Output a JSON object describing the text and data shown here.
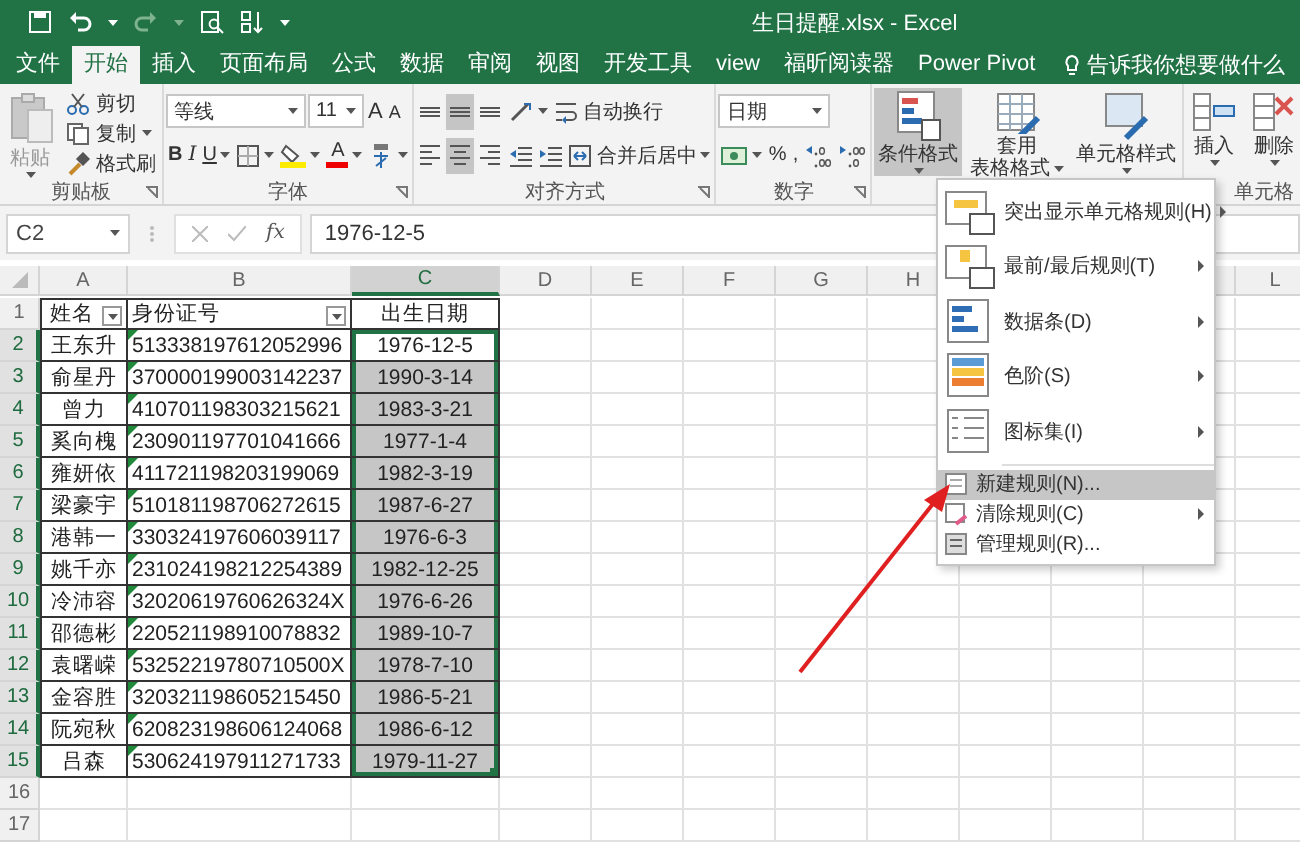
{
  "title_bar": {
    "title": "生日提醒.xlsx - Excel"
  },
  "tabs": [
    {
      "label": "文件",
      "selected": false
    },
    {
      "label": "开始",
      "selected": true
    },
    {
      "label": "插入",
      "selected": false
    },
    {
      "label": "页面布局",
      "selected": false
    },
    {
      "label": "公式",
      "selected": false
    },
    {
      "label": "数据",
      "selected": false
    },
    {
      "label": "审阅",
      "selected": false
    },
    {
      "label": "视图",
      "selected": false
    },
    {
      "label": "开发工具",
      "selected": false
    },
    {
      "label": "view",
      "selected": false
    },
    {
      "label": "福昕阅读器",
      "selected": false
    },
    {
      "label": "Power Pivot",
      "selected": false
    }
  ],
  "tell_me": "告诉我你想要做什么",
  "ribbon": {
    "groups": [
      {
        "label": "剪贴板",
        "launcher": true,
        "items": [
          {
            "kind": "paste",
            "label": "粘贴",
            "disabled": true,
            "dropdown": true
          },
          {
            "kind": "cut",
            "label": "剪切",
            "disabled": false,
            "dropdown": false
          },
          {
            "kind": "copy",
            "label": "复制",
            "disabled": false,
            "dropdown": true
          },
          {
            "kind": "brush",
            "label": "格式刷",
            "disabled": false,
            "dropdown": false
          }
        ]
      },
      {
        "label": "字体",
        "launcher": true,
        "lines": [
          [
            {
              "kind": "font-name",
              "value": "等线"
            },
            {
              "kind": "font-size",
              "value": "11"
            },
            {
              "kind": "grow",
              "label": "A"
            },
            {
              "kind": "shrink",
              "label": "A"
            }
          ],
          [
            {
              "kind": "bold",
              "label": "B"
            },
            {
              "kind": "italic",
              "label": "I"
            },
            {
              "kind": "underline",
              "label": "U",
              "dropdown": true
            },
            {
              "kind": "borders",
              "dropdown": true
            },
            {
              "kind": "fill-color",
              "dropdown": true
            },
            {
              "kind": "font-color",
              "label": "A",
              "dropdown": true
            },
            {
              "kind": "phonetic",
              "dropdown": true
            }
          ]
        ]
      },
      {
        "label": "对齐方式",
        "launcher": true,
        "lines": [
          [
            {
              "kind": "align-top",
              "pressed": false
            },
            {
              "kind": "align-middle",
              "pressed": true
            },
            {
              "kind": "align-bottom",
              "pressed": false
            },
            {
              "kind": "orientation",
              "pressed": false,
              "dropdown": true
            },
            {
              "kind": "wrap",
              "label": "自动换行",
              "pressed": false
            }
          ],
          [
            {
              "kind": "align-left",
              "pressed": false
            },
            {
              "kind": "align-center",
              "pressed": true
            },
            {
              "kind": "align-right",
              "pressed": false
            },
            {
              "kind": "indent-less",
              "pressed": false
            },
            {
              "kind": "indent-more",
              "pressed": false
            },
            {
              "kind": "merge",
              "label": "合并后居中",
              "pressed": false,
              "dropdown": true
            }
          ]
        ]
      },
      {
        "label": "数字",
        "launcher": true,
        "lines": [
          [
            {
              "kind": "format",
              "value": "日期"
            }
          ],
          [
            {
              "kind": "currency",
              "dropdown": true
            },
            {
              "kind": "percent",
              "label": "%"
            },
            {
              "kind": "comma",
              "label": ","
            },
            {
              "kind": "dec-more"
            },
            {
              "kind": "dec-less"
            }
          ]
        ]
      },
      {
        "items": [
          {
            "kind": "cond-format",
            "label": "条件格式",
            "pressed": true,
            "dropdown": true
          },
          {
            "kind": "table-format",
            "label_lines": [
              "套用",
              "表格格式"
            ],
            "pressed": false,
            "dropdown": true
          },
          {
            "kind": "cell-styles",
            "label": "单元格样式",
            "pressed": false,
            "dropdown": true
          }
        ]
      },
      {
        "label": "单元格",
        "launcher": false,
        "items": [
          {
            "kind": "insert",
            "label": "插入",
            "pressed": false,
            "dropdown": true
          },
          {
            "kind": "delete",
            "label": "删除",
            "pressed": false,
            "dropdown": true
          }
        ]
      }
    ]
  },
  "formula_bar": {
    "name_box": "C2",
    "function_button": "fx",
    "formula": "1976-12-5"
  },
  "sheet": {
    "columns": [
      {
        "label": "A",
        "selected": false
      },
      {
        "label": "B",
        "selected": false
      },
      {
        "label": "C",
        "selected": true
      },
      {
        "label": "D",
        "selected": false
      },
      {
        "label": "E",
        "selected": false
      },
      {
        "label": "F",
        "selected": false
      },
      {
        "label": "G",
        "selected": false
      },
      {
        "label": "H",
        "selected": false
      },
      {
        "label": "L",
        "selected": false
      }
    ],
    "rows": [
      {
        "label": "1",
        "selected": false,
        "cells": [
          {
            "text": "姓名",
            "filter": true,
            "selected": false
          },
          {
            "text": "身份证号",
            "filter": true,
            "selected": false
          },
          {
            "text": "出生日期",
            "filter": false,
            "selected": false
          }
        ]
      },
      {
        "label": "2",
        "selected": true,
        "cells": [
          {
            "text": "王东升",
            "selected": false
          },
          {
            "text": "513338197612052996",
            "flag": true,
            "selected": false
          },
          {
            "text": "1976-12-5",
            "selected": true,
            "active": true
          }
        ]
      },
      {
        "label": "3",
        "selected": true,
        "cells": [
          {
            "text": "俞星丹",
            "selected": false
          },
          {
            "text": "370000199003142237",
            "flag": true,
            "selected": false
          },
          {
            "text": "1990-3-14",
            "selected": true,
            "active": false
          }
        ]
      },
      {
        "label": "4",
        "selected": true,
        "cells": [
          {
            "text": "曾力",
            "selected": false
          },
          {
            "text": "410701198303215621",
            "flag": true,
            "selected": false
          },
          {
            "text": "1983-3-21",
            "selected": true,
            "active": false
          }
        ]
      },
      {
        "label": "5",
        "selected": true,
        "cells": [
          {
            "text": "奚向槐",
            "selected": false
          },
          {
            "text": "230901197701041666",
            "flag": true,
            "selected": false
          },
          {
            "text": "1977-1-4",
            "selected": true,
            "active": false
          }
        ]
      },
      {
        "label": "6",
        "selected": true,
        "cells": [
          {
            "text": "雍妍依",
            "selected": false
          },
          {
            "text": "411721198203199069",
            "flag": true,
            "selected": false
          },
          {
            "text": "1982-3-19",
            "selected": true,
            "active": false
          }
        ]
      },
      {
        "label": "7",
        "selected": true,
        "cells": [
          {
            "text": "梁豪宇",
            "selected": false
          },
          {
            "text": "510181198706272615",
            "flag": true,
            "selected": false
          },
          {
            "text": "1987-6-27",
            "selected": true,
            "active": false
          }
        ]
      },
      {
        "label": "8",
        "selected": true,
        "cells": [
          {
            "text": "港韩一",
            "selected": false
          },
          {
            "text": "330324197606039117",
            "flag": true,
            "selected": false
          },
          {
            "text": "1976-6-3",
            "selected": true,
            "active": false
          }
        ]
      },
      {
        "label": "9",
        "selected": true,
        "cells": [
          {
            "text": "姚千亦",
            "selected": false
          },
          {
            "text": "231024198212254389",
            "flag": true,
            "selected": false
          },
          {
            "text": "1982-12-25",
            "selected": true,
            "active": false
          }
        ]
      },
      {
        "label": "10",
        "selected": true,
        "cells": [
          {
            "text": "冷沛容",
            "selected": false
          },
          {
            "text": "32020619760626324X",
            "flag": true,
            "selected": false
          },
          {
            "text": "1976-6-26",
            "selected": true,
            "active": false
          }
        ]
      },
      {
        "label": "11",
        "selected": true,
        "cells": [
          {
            "text": "邵德彬",
            "selected": false
          },
          {
            "text": "220521198910078832",
            "flag": true,
            "selected": false
          },
          {
            "text": "1989-10-7",
            "selected": true,
            "active": false
          }
        ]
      },
      {
        "label": "12",
        "selected": true,
        "cells": [
          {
            "text": "袁曙嵘",
            "selected": false
          },
          {
            "text": "53252219780710500X",
            "flag": true,
            "selected": false
          },
          {
            "text": "1978-7-10",
            "selected": true,
            "active": false
          }
        ]
      },
      {
        "label": "13",
        "selected": true,
        "cells": [
          {
            "text": "金容胜",
            "selected": false
          },
          {
            "text": "320321198605215450",
            "flag": true,
            "selected": false
          },
          {
            "text": "1986-5-21",
            "selected": true,
            "active": false
          }
        ]
      },
      {
        "label": "14",
        "selected": true,
        "cells": [
          {
            "text": "阮宛秋",
            "selected": false
          },
          {
            "text": "620823198606124068",
            "flag": true,
            "selected": false
          },
          {
            "text": "1986-6-12",
            "selected": true,
            "active": false
          }
        ]
      },
      {
        "label": "15",
        "selected": true,
        "cells": [
          {
            "text": "吕森",
            "selected": false
          },
          {
            "text": "530624197911271733",
            "flag": true,
            "selected": false
          },
          {
            "text": "1979-11-27",
            "selected": true,
            "active": false
          }
        ]
      },
      {
        "label": "16",
        "selected": false,
        "cells": []
      },
      {
        "label": "17",
        "selected": false,
        "cells": []
      }
    ]
  },
  "menu": {
    "items": [
      {
        "kind": "highlight-rules",
        "label": "突出显示单元格规则(H)",
        "submenu": true,
        "highlighted": false
      },
      {
        "kind": "top-bottom",
        "label": "最前/最后规则(T)",
        "submenu": true,
        "highlighted": false
      },
      {
        "kind": "data-bars",
        "label": "数据条(D)",
        "submenu": true,
        "highlighted": false
      },
      {
        "kind": "color-scales",
        "label": "色阶(S)",
        "submenu": true,
        "highlighted": false
      },
      {
        "kind": "icon-sets",
        "label": "图标集(I)",
        "submenu": true,
        "highlighted": false
      },
      {
        "kind": "new-rule",
        "label": "新建规则(N)...",
        "submenu": false,
        "highlighted": true
      },
      {
        "kind": "clear-rules",
        "label": "清除规则(C)",
        "submenu": true,
        "highlighted": false
      },
      {
        "kind": "manage-rules",
        "label": "管理规则(R)...",
        "submenu": false,
        "highlighted": false
      }
    ]
  }
}
